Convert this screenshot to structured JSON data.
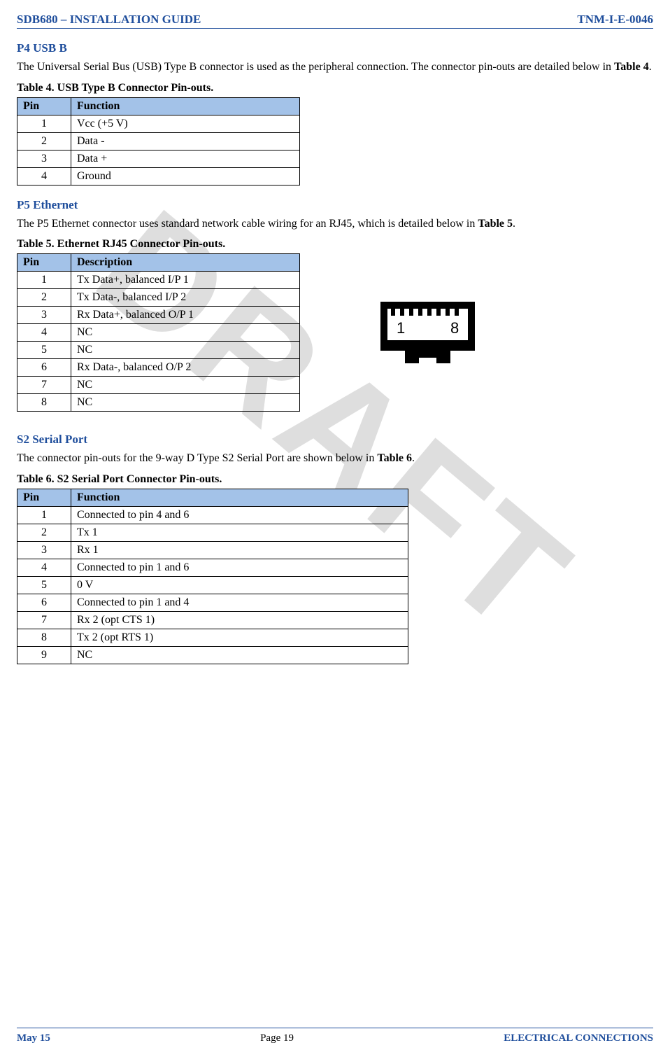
{
  "header": {
    "left": "SDB680 – INSTALLATION GUIDE",
    "right": "TNM-I-E-0046"
  },
  "watermark": "DRAFT",
  "section_usb": {
    "heading": "P4 USB B",
    "para_a": "The Universal Serial Bus (USB) Type B connector is used as the peripheral connection.  The connector pin-outs are detailed below in ",
    "para_b_bold": "Table 4",
    "para_c": "."
  },
  "table4": {
    "caption": "Table 4.  USB Type B Connector Pin-outs.",
    "head_pin": "Pin",
    "head_func": "Function",
    "rows": [
      {
        "pin": "1",
        "func": "Vcc (+5 V)"
      },
      {
        "pin": "2",
        "func": "Data -"
      },
      {
        "pin": "3",
        "func": "Data +"
      },
      {
        "pin": "4",
        "func": "Ground"
      }
    ]
  },
  "section_eth": {
    "heading": "P5 Ethernet",
    "para_a": "The P5 Ethernet connector uses standard network cable wiring for an RJ45, which is detailed below in ",
    "para_b_bold": "Table 5",
    "para_c": "."
  },
  "table5": {
    "caption": "Table 5.  Ethernet RJ45 Connector Pin-outs.",
    "head_pin": "Pin",
    "head_func": "Description",
    "rows": [
      {
        "pin": "1",
        "func": "Tx Data+, balanced I/P 1"
      },
      {
        "pin": "2",
        "func": "Tx Data-, balanced I/P 2"
      },
      {
        "pin": "3",
        "func": "Rx Data+, balanced O/P 1"
      },
      {
        "pin": "4",
        "func": "NC"
      },
      {
        "pin": "5",
        "func": "NC"
      },
      {
        "pin": "6",
        "func": "Rx Data-, balanced O/P 2"
      },
      {
        "pin": "7",
        "func": "NC"
      },
      {
        "pin": "8",
        "func": "NC"
      }
    ]
  },
  "rj45": {
    "left_label": "1",
    "right_label": "8"
  },
  "section_serial": {
    "heading": "S2 Serial Port",
    "para_a": "The connector pin-outs for the 9-way D Type S2 Serial Port are shown below in ",
    "para_b_bold": "Table 6",
    "para_c": "."
  },
  "table6": {
    "caption": "Table 6.  S2 Serial Port Connector Pin-outs.",
    "head_pin": "Pin",
    "head_func": "Function",
    "rows": [
      {
        "pin": "1",
        "func": "Connected to pin 4 and 6"
      },
      {
        "pin": "2",
        "func": "Tx 1"
      },
      {
        "pin": "3",
        "func": "Rx 1"
      },
      {
        "pin": "4",
        "func": "Connected to pin 1 and 6"
      },
      {
        "pin": "5",
        "func": "0 V"
      },
      {
        "pin": "6",
        "func": "Connected to pin 1 and 4"
      },
      {
        "pin": "7",
        "func": "Rx 2 (opt CTS 1)"
      },
      {
        "pin": "8",
        "func": "Tx 2 (opt RTS 1)"
      },
      {
        "pin": "9",
        "func": "NC"
      }
    ]
  },
  "footer": {
    "left": "May 15",
    "center": "Page 19",
    "right": "ELECTRICAL CONNECTIONS"
  }
}
